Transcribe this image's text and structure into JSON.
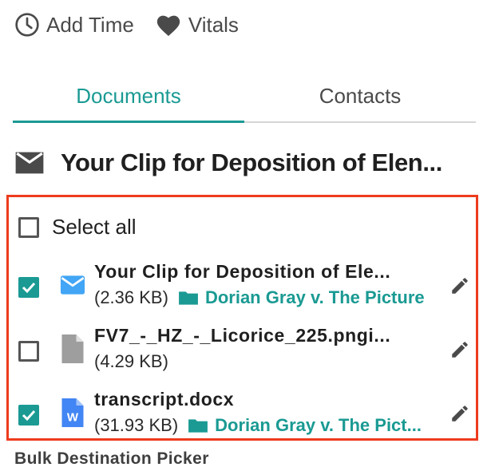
{
  "top_actions": {
    "add_time_label": "Add Time",
    "vitals_label": "Vitals"
  },
  "tabs": [
    {
      "label": "Documents",
      "active": true
    },
    {
      "label": "Contacts",
      "active": false
    }
  ],
  "email": {
    "title": "Your Clip for Deposition of Elen..."
  },
  "select_all": {
    "label": "Select all",
    "checked": false
  },
  "documents": [
    {
      "name": "Your Clip for Deposition of Ele...",
      "size": "(2.36 KB)",
      "folder": "Dorian Gray v. The Picture",
      "checked": true,
      "icon": "email-icon"
    },
    {
      "name": "FV7_-_HZ_-_Licorice_225.pngi...",
      "size": "(4.29 KB)",
      "folder": "",
      "checked": false,
      "icon": "file-icon"
    },
    {
      "name": "transcript.docx",
      "size": "(31.93 KB)",
      "folder": "Dorian Gray v. The Pict...",
      "checked": true,
      "icon": "word-doc-icon"
    }
  ],
  "footer": {
    "label": "Bulk Destination Picker"
  },
  "colors": {
    "accent": "#1a9a93",
    "highlight_border": "#ee3b1d",
    "email_icon_blue": "#42a5f5",
    "word_blue": "#4285f4"
  }
}
